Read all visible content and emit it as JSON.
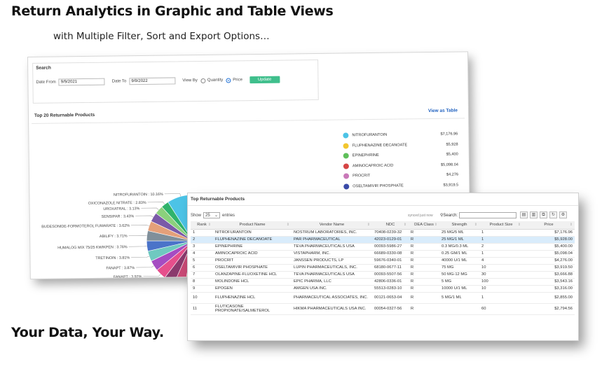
{
  "heading": "Return Analytics in Graphic and Table Views",
  "subheading": "with Multiple Filter, Sort and Export Options…",
  "tagline": "Your Data, Your Way.",
  "search_panel": {
    "title": "Search",
    "date_from_label": "Date From",
    "date_from": "9/9/2021",
    "date_to_label": "Date To",
    "date_to": "9/9/2022",
    "view_by_label": "View By",
    "opt_quantity": "Quantity",
    "opt_price": "Price",
    "selected": "Price",
    "update_label": "Update"
  },
  "chart_panel": {
    "title": "Top 20 Returnable Products",
    "view_table_label": "View as Table"
  },
  "chart_data": {
    "type": "pie",
    "slices": [
      {
        "label": "NITROFURANTOIN : 10.16%",
        "value": 10.16,
        "color": "#4cc3e6"
      },
      {
        "label": "OXICONAZOLE NITRATE : 2.83%",
        "value": 2.83,
        "color": "#2fb36b"
      },
      {
        "label": "UROXATRAL : 3.13%",
        "value": 3.13,
        "color": "#8bd17c"
      },
      {
        "label": "SENSIPAR : 3.43%",
        "value": 3.43,
        "color": "#7a5aa8"
      },
      {
        "label": "BUDESONIDE-FORMOTEROL FUMARATE : 3.62%",
        "value": 3.62,
        "color": "#e4a07a"
      },
      {
        "label": "ABILIFY : 3.71%",
        "value": 3.71,
        "color": "#7f8f9a"
      },
      {
        "label": "HUMALOG MIX 75/25 KWIKPEN : 3.76%",
        "value": 3.76,
        "color": "#4a73c9"
      },
      {
        "label": "TRETINOIN : 3.81%",
        "value": 3.81,
        "color": "#6fc9c0"
      },
      {
        "label": "FANAPT : 3.87%",
        "value": 3.87,
        "color": "#a54cc2"
      },
      {
        "label": "FANAPT : 3.92%",
        "value": 3.92,
        "color": "#e64f8c"
      },
      {
        "label": "FLUTICASONE PROPIONATE/SALMETEROL : 3.96%",
        "value": 3.96,
        "color": "#8a3a6d"
      },
      {
        "label": "FLUPHENAZINE HCL : 4.04%",
        "value": 4.04,
        "color": "#c94a76"
      },
      {
        "label": "EPOGEN : 4.70%",
        "value": 4.7,
        "color": "#d96a3c"
      },
      {
        "label": "",
        "value": 5.0,
        "color": "#8c9a3a"
      },
      {
        "label": "",
        "value": 5.2,
        "color": "#b8b24a"
      }
    ]
  },
  "legend": [
    {
      "name": "NITROFURANTOIN",
      "value": "$7,176.96",
      "color": "#4cc3e6"
    },
    {
      "name": "FLUPHENAZINE DECANOATE",
      "value": "$5,928",
      "color": "#f2c62f"
    },
    {
      "name": "EPINEPHRINE",
      "value": "$5,400",
      "color": "#5fbf5a"
    },
    {
      "name": "AMINOCAPROIC ACID",
      "value": "$5,098.04",
      "color": "#d64545"
    },
    {
      "name": "PROCRIT",
      "value": "$4,276",
      "color": "#c978b8"
    },
    {
      "name": "OSELTAMIVIR PHOSPHATE",
      "value": "$3,919.5",
      "color": "#3a4aa8"
    }
  ],
  "table_panel": {
    "title": "Top Returnable Products",
    "show_label": "Show",
    "show_value": "25",
    "entries_label": "entries",
    "synced": "synced just now",
    "search_label": "Search:",
    "columns": [
      "Rank",
      "Product Name",
      "Vendor Name",
      "NDC",
      "DEA Class",
      "Strength",
      "Product Size",
      "Price"
    ],
    "rows": [
      [
        "1",
        "NITROFURANTOIN",
        "NOSTRUM LABORATORIES, INC.",
        "70408-0239-32",
        "R",
        "25 MG/5 ML",
        "1",
        "$7,176.96"
      ],
      [
        "2",
        "FLUPHENAZINE DECANOATE",
        "PAR PHARMACEUTICAL",
        "42023-0129-01",
        "R",
        "25 MG/1 ML",
        "1",
        "$5,928.00"
      ],
      [
        "3",
        "EPINEPHRINE",
        "TEVA PHARMACEUTICALS USA",
        "00093-5986-27",
        "R",
        "0.3 MG/0.3 ML",
        "2",
        "$5,400.00"
      ],
      [
        "4",
        "AMINOCAPROIC ACID",
        "VISTAPHARM, INC.",
        "66689-0330-08",
        "R",
        "0.25 GM/1 ML",
        "1",
        "$5,098.04"
      ],
      [
        "5",
        "PROCRIT",
        "JANSSEN PRODUCTS, LP",
        "59676-0340-01",
        "R",
        "40000 U/1 ML",
        "4",
        "$4,276.00"
      ],
      [
        "6",
        "OSELTAMIVIR PHOSPHATE",
        "LUPIN PHARMACEUTICALS, INC.",
        "68180-0677-11",
        "R",
        "75 MG",
        "10",
        "$3,919.50"
      ],
      [
        "7",
        "OLANZAPINE-FLUOXETINE HCL",
        "TEVA PHARMACEUTICALS USA",
        "00093-5507-56",
        "R",
        "50 MG-12 MG",
        "30",
        "$3,666.88"
      ],
      [
        "8",
        "MOLINDONE HCL",
        "EPIC PHARMA, LLC",
        "42806-0336-01",
        "R",
        "5 MG",
        "100",
        "$3,543.16"
      ],
      [
        "9",
        "EPOGEN",
        "AMGEN USA INC.",
        "55513-0283-10",
        "R",
        "10000 U/1 ML",
        "10",
        "$3,316.00"
      ],
      [
        "10",
        "FLUPHENAZINE HCL",
        "PHARMACEUTICAL ASSOCIATES, INC.",
        "00121-0653-04",
        "R",
        "5 MG/1 ML",
        "1",
        "$2,855.00"
      ],
      [
        "11",
        "FLUTICASONE PROPIONATE/SALMETEROL",
        "HIKMA PHARMACEUTICALS USA INC.",
        "00054-0327-56",
        "R",
        "",
        "60",
        "$2,794.56"
      ]
    ]
  }
}
